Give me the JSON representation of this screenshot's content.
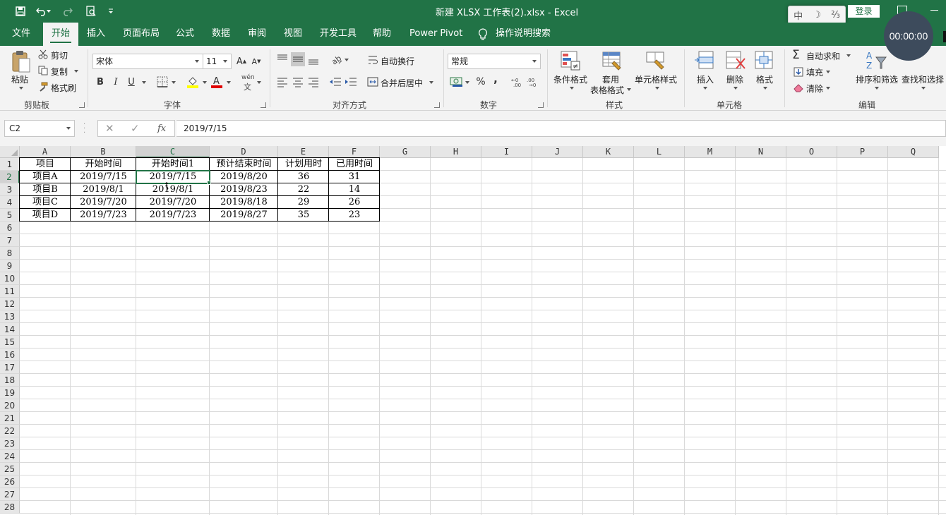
{
  "titlebar": {
    "title": "新建 XLSX 工作表(2).xlsx  -  Excel",
    "ime": [
      "中",
      "☽",
      "⅔"
    ],
    "login_label": "登录"
  },
  "tabs": [
    "文件",
    "开始",
    "插入",
    "页面布局",
    "公式",
    "数据",
    "审阅",
    "视图",
    "开发工具",
    "帮助",
    "Power Pivot",
    "操作说明搜索"
  ],
  "ribbon": {
    "clipboard": {
      "paste": "粘贴",
      "cut": "剪切",
      "copy": "复制",
      "format_painter": "格式刷",
      "title": "剪贴板"
    },
    "font": {
      "name": "宋体",
      "size": "11",
      "title": "字体",
      "bold": "B",
      "italic": "I",
      "underline": "U",
      "wen": "wén",
      "wen_char": "文"
    },
    "alignment": {
      "wrap": "自动换行",
      "merge": "合并后居中",
      "title": "对齐方式"
    },
    "number": {
      "format": "常规",
      "percent": "%",
      "comma": ",",
      "title": "数字"
    },
    "styles": {
      "conditional": "条件格式",
      "table_line1": "套用",
      "table_line2": "表格格式",
      "cell_styles": "单元格样式",
      "title": "样式"
    },
    "cells": {
      "insert": "插入",
      "delete": "删除",
      "format": "格式",
      "title": "单元格"
    },
    "editing": {
      "autosum": "自动求和",
      "fill": "填充",
      "clear": "清除",
      "sort_filter": "排序和筛选",
      "find_select": "查找和选择",
      "title": "编辑"
    }
  },
  "formula_bar": {
    "name_box": "C2",
    "fx_label": "fx",
    "value": "2019/7/15"
  },
  "sheet": {
    "columns": [
      "A",
      "B",
      "C",
      "D",
      "E",
      "F",
      "G",
      "H",
      "I",
      "J",
      "K",
      "L",
      "M",
      "N",
      "O",
      "P",
      "Q"
    ],
    "rows": [
      "1",
      "2",
      "3",
      "4",
      "5",
      "6",
      "7",
      "8",
      "9",
      "10",
      "11",
      "12",
      "13",
      "14",
      "15",
      "16",
      "17",
      "18",
      "19",
      "20",
      "21",
      "22",
      "23",
      "24",
      "25",
      "26",
      "27",
      "28"
    ],
    "header": [
      "项目",
      "开始时间",
      "开始时间1",
      "预计结束时间",
      "计划用时",
      "已用时间"
    ],
    "data": [
      [
        "项目A",
        "2019/7/15",
        "2019/7/15",
        "2019/8/20",
        "36",
        "31"
      ],
      [
        "项目B",
        "2019/8/1",
        "2019/8/1",
        "2019/8/23",
        "22",
        "14"
      ],
      [
        "项目C",
        "2019/7/20",
        "2019/7/20",
        "2019/8/18",
        "29",
        "26"
      ],
      [
        "项目D",
        "2019/7/23",
        "2019/7/23",
        "2019/8/27",
        "35",
        "23"
      ]
    ]
  },
  "timer": "00:00:00"
}
